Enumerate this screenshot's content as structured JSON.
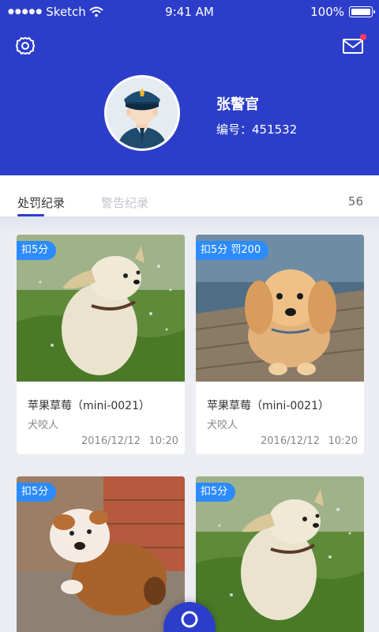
{
  "status_bar": {
    "carrier": "Sketch",
    "time": "9:41 AM",
    "battery": "100%",
    "signal_icon": "signal-dots-icon",
    "wifi_icon": "wifi-icon"
  },
  "header": {
    "settings_icon": "gear-icon",
    "mail_icon": "mail-icon",
    "user": {
      "name": "张警官",
      "id_text": "编号：451532"
    },
    "colors": {
      "background": "#2c3ec9",
      "badge": "#2c8bff",
      "notification": "#ff3b5c"
    }
  },
  "tabs": [
    {
      "label": "处罚纪录",
      "active": true
    },
    {
      "label": "警告纪录",
      "active": false
    }
  ],
  "count": "56",
  "cards": [
    {
      "badge": "扣5分",
      "title": "苹果草莓（mini-0021）",
      "subtitle": "犬咬人",
      "date": "2016/12/12",
      "time": "10:20"
    },
    {
      "badge": "扣5分 罚200",
      "title": "苹果草莓（mini-0021）",
      "subtitle": "犬咬人",
      "date": "2016/12/12",
      "time": "10:20"
    },
    {
      "badge": "扣5分"
    },
    {
      "badge": "扣5分"
    }
  ],
  "fab_icon": "search-icon"
}
